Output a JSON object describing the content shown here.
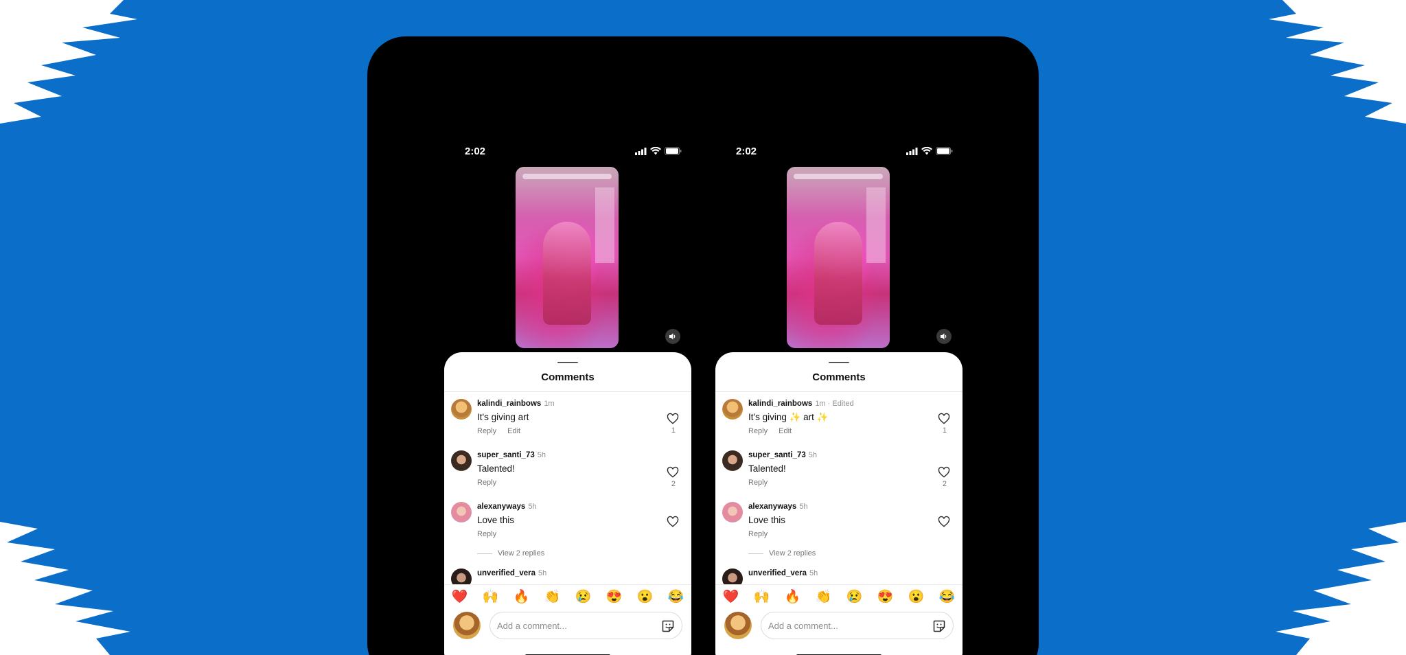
{
  "colors": {
    "background": "#0b6fca",
    "device": "#000000",
    "sheet": "#ffffff"
  },
  "phones": [
    {
      "status": {
        "time": "2:02"
      },
      "sheet": {
        "title": "Comments",
        "comments": [
          {
            "author": "kalindi_rainbows",
            "meta": "1m",
            "text": "It's giving art",
            "reply": "Reply",
            "edit": "Edit",
            "likes": "1"
          },
          {
            "author": "super_santi_73",
            "meta": "5h",
            "text": "Talented!",
            "reply": "Reply",
            "likes": "2"
          },
          {
            "author": "alexanyways",
            "meta": "5h",
            "text": "Love this",
            "reply": "Reply"
          },
          {
            "author": "unverified_vera",
            "meta": "5h"
          }
        ],
        "view_replies": "View 2 replies",
        "emojis": [
          "❤️",
          "🙌",
          "🔥",
          "👏",
          "😢",
          "😍",
          "😮",
          "😂"
        ],
        "input_placeholder": "Add a comment..."
      }
    },
    {
      "status": {
        "time": "2:02"
      },
      "sheet": {
        "title": "Comments",
        "comments": [
          {
            "author": "kalindi_rainbows",
            "meta": "1m · Edited",
            "text": "It's giving ✨ art ✨",
            "reply": "Reply",
            "edit": "Edit",
            "likes": "1"
          },
          {
            "author": "super_santi_73",
            "meta": "5h",
            "text": "Talented!",
            "reply": "Reply",
            "likes": "2"
          },
          {
            "author": "alexanyways",
            "meta": "5h",
            "text": "Love this",
            "reply": "Reply"
          },
          {
            "author": "unverified_vera",
            "meta": "5h"
          }
        ],
        "view_replies": "View 2 replies",
        "emojis": [
          "❤️",
          "🙌",
          "🔥",
          "👏",
          "😢",
          "😍",
          "😮",
          "😂"
        ],
        "input_placeholder": "Add a comment..."
      }
    }
  ],
  "icons": {
    "status": [
      "signal-icon",
      "wifi-icon",
      "battery-icon"
    ],
    "sound": "speaker-icon",
    "like": "heart-icon",
    "sticker": "sticker-icon"
  }
}
